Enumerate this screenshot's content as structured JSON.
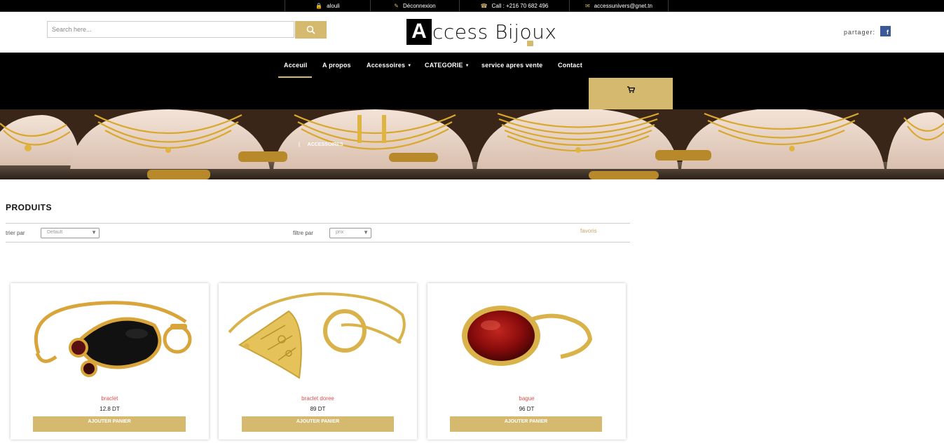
{
  "topbar": {
    "user": "alouli",
    "logout": "Déconnexion",
    "call": "Call : +216 70 682 496",
    "email": "accessunivers@gnet.tn"
  },
  "header": {
    "search_placeholder": "Search here...",
    "logo_letter": "A",
    "logo_rest": "ccess Bijoux",
    "share_label": "partager:",
    "facebook": "f"
  },
  "nav": {
    "items": [
      {
        "label": "Acceuil"
      },
      {
        "label": "A propos"
      },
      {
        "label": "Accessoires"
      },
      {
        "label": "CATEGORIE"
      },
      {
        "label": "service apres vente"
      },
      {
        "label": "Contact"
      }
    ],
    "active": "Acceuil"
  },
  "banner": {
    "breadcrumb": "ACCESSOIRES"
  },
  "products": {
    "title": "PRODUITS",
    "sort_label": "trier par",
    "sort_value": "Default",
    "filter_label": "filtre par",
    "filter_value": "prix",
    "favorites": "favoris",
    "items": [
      {
        "name": "braclet",
        "price": "12.8 DT",
        "button": "AJOUTER PANIER"
      },
      {
        "name": "braclet doree",
        "price": "89 DT",
        "button": "AJOUTER PANIER"
      },
      {
        "name": "bague",
        "price": "96 DT",
        "button": "AJOUTER PANIER"
      }
    ]
  },
  "colors": {
    "accent": "#d4b96e",
    "product_name": "#d9534f",
    "nav_bg": "#000000"
  }
}
